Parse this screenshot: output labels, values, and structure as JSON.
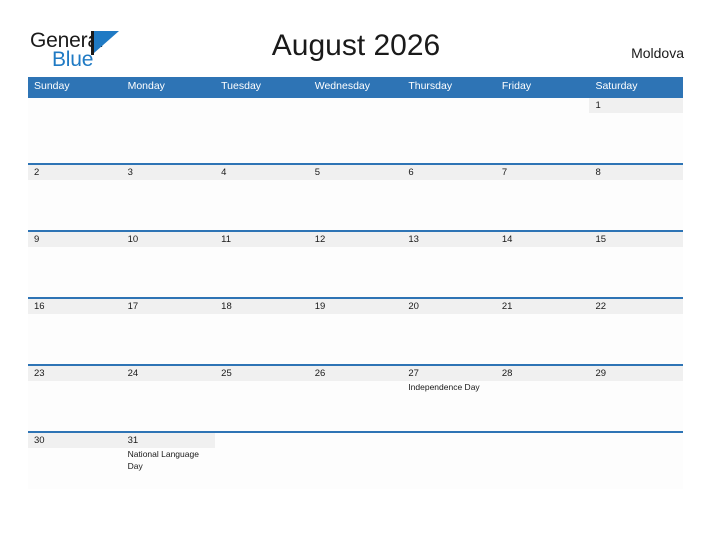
{
  "brand": {
    "word_one": "General",
    "word_two": "Blue",
    "flag_icon": "flag-icon",
    "accent_color": "#1f7ac4"
  },
  "header": {
    "title": "August 2026",
    "country": "Moldova"
  },
  "colors": {
    "header_blue": "#2e74b5",
    "row_band_gray": "#f0f0f0",
    "text": "#1a1a1a"
  },
  "calendar": {
    "weekdays": [
      "Sunday",
      "Monday",
      "Tuesday",
      "Wednesday",
      "Thursday",
      "Friday",
      "Saturday"
    ],
    "weeks": [
      [
        {
          "day": "",
          "event": ""
        },
        {
          "day": "",
          "event": ""
        },
        {
          "day": "",
          "event": ""
        },
        {
          "day": "",
          "event": ""
        },
        {
          "day": "",
          "event": ""
        },
        {
          "day": "",
          "event": ""
        },
        {
          "day": "1",
          "event": ""
        }
      ],
      [
        {
          "day": "2",
          "event": ""
        },
        {
          "day": "3",
          "event": ""
        },
        {
          "day": "4",
          "event": ""
        },
        {
          "day": "5",
          "event": ""
        },
        {
          "day": "6",
          "event": ""
        },
        {
          "day": "7",
          "event": ""
        },
        {
          "day": "8",
          "event": ""
        }
      ],
      [
        {
          "day": "9",
          "event": ""
        },
        {
          "day": "10",
          "event": ""
        },
        {
          "day": "11",
          "event": ""
        },
        {
          "day": "12",
          "event": ""
        },
        {
          "day": "13",
          "event": ""
        },
        {
          "day": "14",
          "event": ""
        },
        {
          "day": "15",
          "event": ""
        }
      ],
      [
        {
          "day": "16",
          "event": ""
        },
        {
          "day": "17",
          "event": ""
        },
        {
          "day": "18",
          "event": ""
        },
        {
          "day": "19",
          "event": ""
        },
        {
          "day": "20",
          "event": ""
        },
        {
          "day": "21",
          "event": ""
        },
        {
          "day": "22",
          "event": ""
        }
      ],
      [
        {
          "day": "23",
          "event": ""
        },
        {
          "day": "24",
          "event": ""
        },
        {
          "day": "25",
          "event": ""
        },
        {
          "day": "26",
          "event": ""
        },
        {
          "day": "27",
          "event": "Independence Day"
        },
        {
          "day": "28",
          "event": ""
        },
        {
          "day": "29",
          "event": ""
        }
      ],
      [
        {
          "day": "30",
          "event": ""
        },
        {
          "day": "31",
          "event": "National Language Day"
        },
        {
          "day": "",
          "event": ""
        },
        {
          "day": "",
          "event": ""
        },
        {
          "day": "",
          "event": ""
        },
        {
          "day": "",
          "event": ""
        },
        {
          "day": "",
          "event": ""
        }
      ]
    ]
  }
}
